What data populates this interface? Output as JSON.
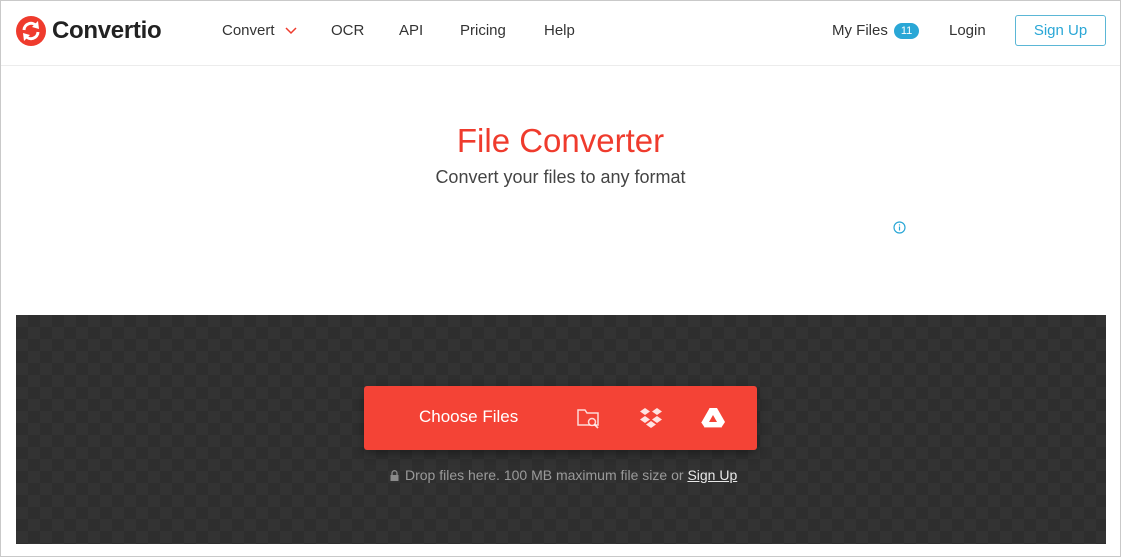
{
  "brand": {
    "name": "Convertio",
    "color": "#ef3b2d"
  },
  "nav": {
    "convert": "Convert",
    "ocr": "OCR",
    "api": "API",
    "pricing": "Pricing",
    "help": "Help",
    "my_files": "My Files",
    "my_files_count": "11",
    "login": "Login",
    "sign_up": "Sign Up"
  },
  "hero": {
    "title": "File Converter",
    "subtitle": "Convert your files to any format"
  },
  "upload": {
    "choose_files": "Choose Files",
    "icons": [
      "folder-search-icon",
      "dropbox-icon",
      "google-drive-icon"
    ],
    "drop_text": "Drop files here. 100 MB maximum file size or",
    "sign_up_link": "Sign Up"
  },
  "colors": {
    "accent": "#f44336",
    "badge": "#2aa7d6",
    "dropzone": "#333333"
  }
}
